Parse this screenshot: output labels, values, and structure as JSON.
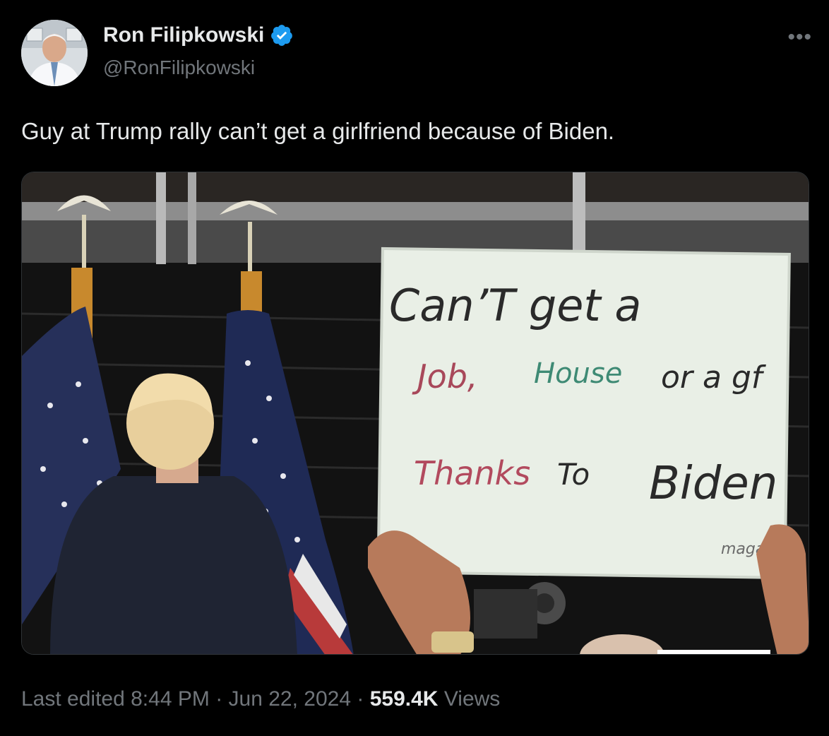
{
  "author": {
    "display_name": "Ron Filipkowski",
    "handle": "@RonFilipkowski",
    "verified": true,
    "verified_color": "#1d9bf0"
  },
  "more_icon": "more-horizontal-icon",
  "tweet": {
    "text": "Guy at Trump rally can’t get a girlfriend because of Biden."
  },
  "media": {
    "sign_lines": [
      "Can’T get a",
      "Job, House or a gf",
      "Thanks To Biden"
    ],
    "sign_line2_parts": [
      "Job,",
      "House",
      "or a gf"
    ],
    "sign_line3_parts": [
      "Thanks",
      "To",
      "Biden"
    ],
    "sign_signature": "maga"
  },
  "footer": {
    "edited_label": "Last edited",
    "time": "8:44 PM",
    "separator": "·",
    "date": "Jun 22, 2024",
    "views_count": "559.4K",
    "views_label": "Views"
  },
  "colors": {
    "background": "#000000",
    "text_primary": "#e7e9ea",
    "text_secondary": "#71767b",
    "border": "#2f3336"
  }
}
